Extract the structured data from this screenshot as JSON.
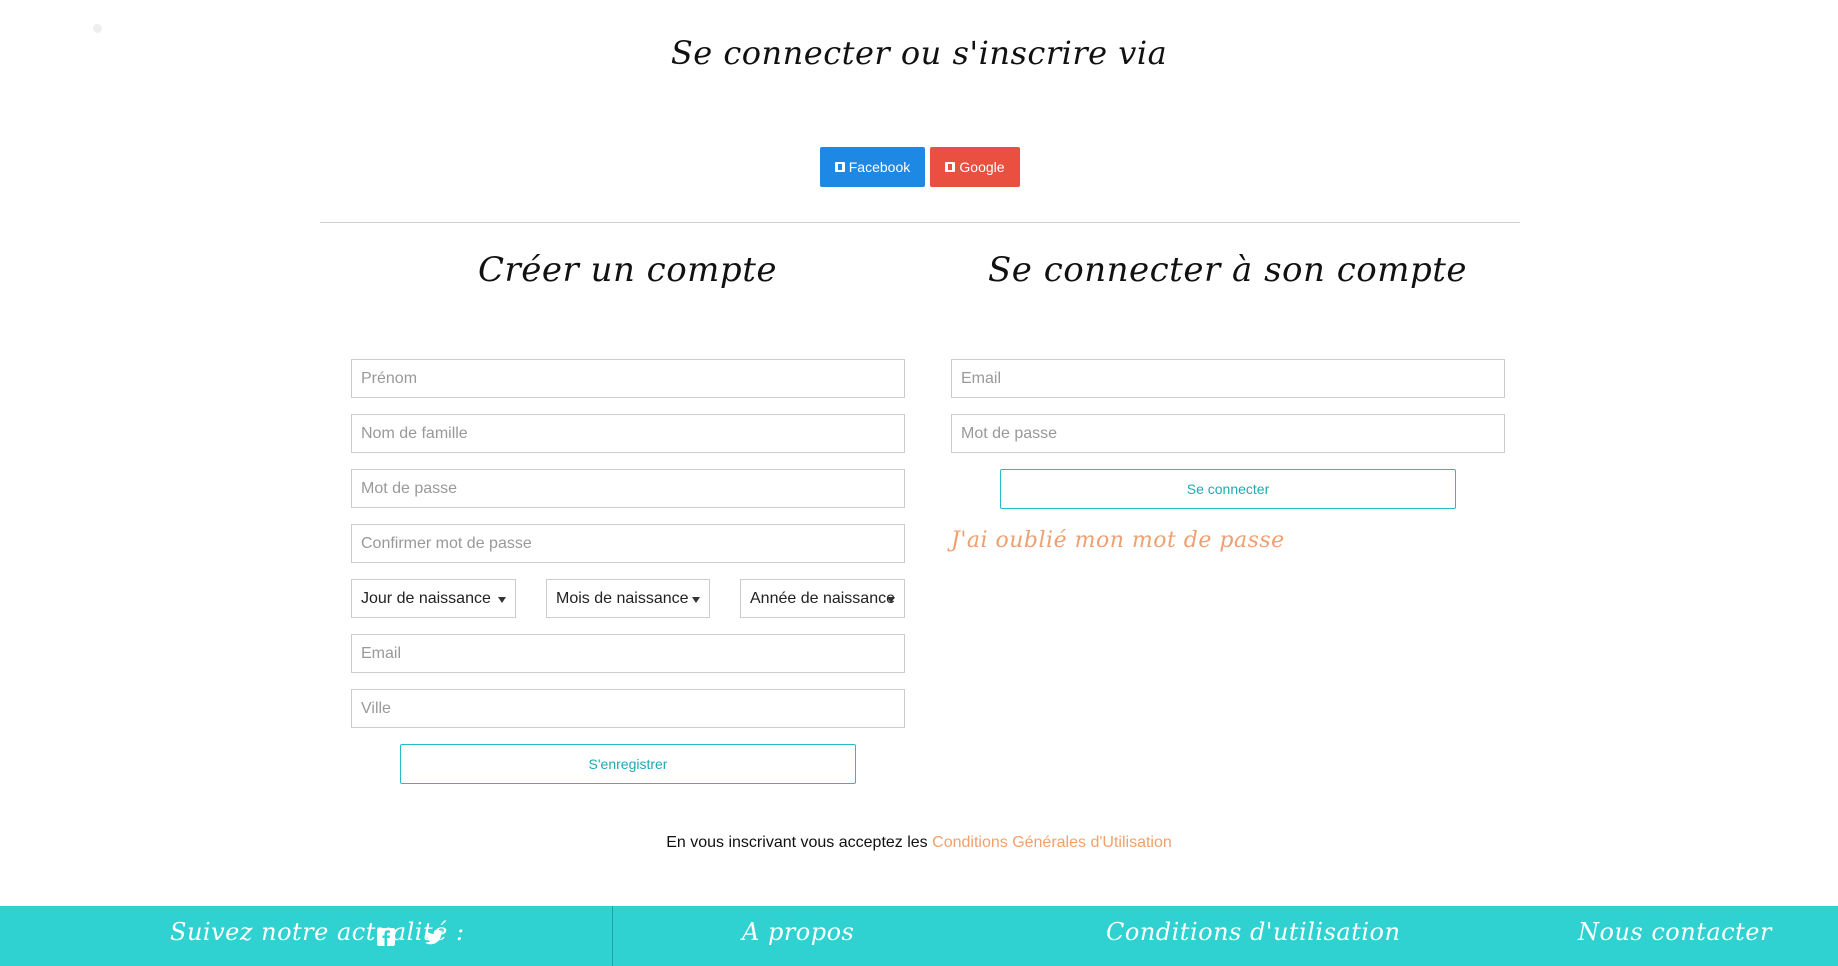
{
  "header": {
    "title": "Se connecter ou s'inscrire via",
    "facebook_label": "Facebook",
    "google_label": "Google"
  },
  "register": {
    "title": "Créer un compte",
    "firstname_placeholder": "Prénom",
    "lastname_placeholder": "Nom de famille",
    "password_placeholder": "Mot de passe",
    "confirm_placeholder": "Confirmer mot de passe",
    "day_label": "Jour de naissance",
    "month_label": "Mois de naissance",
    "year_label": "Année de naissance",
    "email_placeholder": "Email",
    "city_placeholder": "Ville",
    "submit_label": "S'enregistrer"
  },
  "login": {
    "title": "Se connecter à son compte",
    "email_placeholder": "Email",
    "password_placeholder": "Mot de passe",
    "submit_label": "Se connecter",
    "forgot_label": "J'ai oublié mon mot de passe"
  },
  "terms": {
    "text": "En vous inscrivant vous acceptez les",
    "link": "Conditions Générales d'Utilisation"
  },
  "footer": {
    "follow_label": "Suivez notre actualité :",
    "about_label": "A propos",
    "conditions_label": "Conditions d'utilisation",
    "contact_label": "Nous contacter",
    "icons": [
      "facebook-icon",
      "twitter-icon"
    ]
  },
  "colors": {
    "facebook": "#1e88e5",
    "google": "#e9503f",
    "accent": "#26bcc7",
    "link": "#f2a06a",
    "footer": "#2fd1d1"
  }
}
